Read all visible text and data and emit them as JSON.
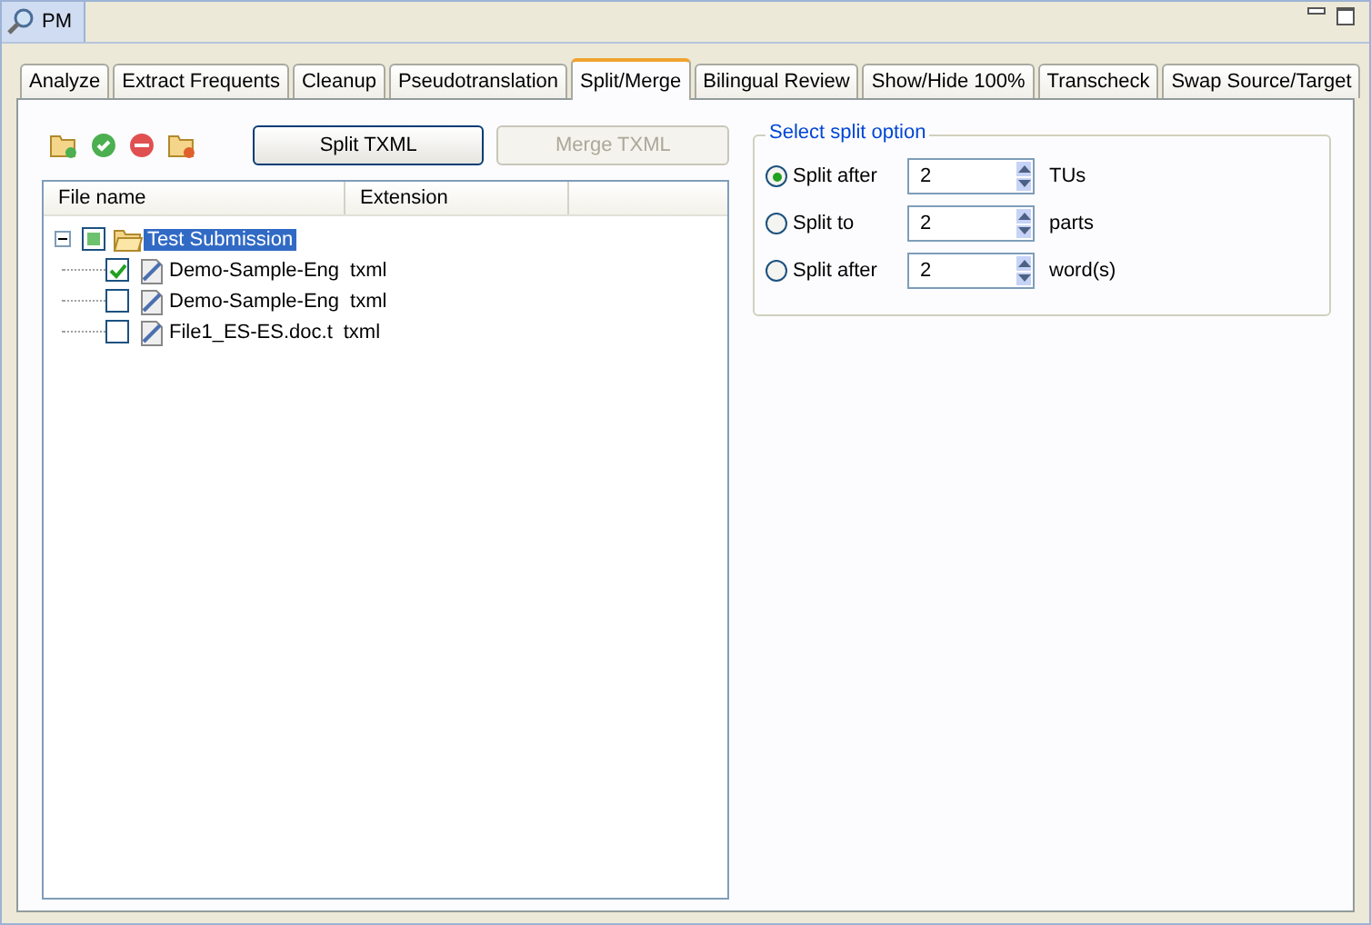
{
  "view_tab": {
    "title": "PM"
  },
  "tabs": [
    {
      "label": "Analyze",
      "selected": false
    },
    {
      "label": "Extract Frequents",
      "selected": false
    },
    {
      "label": "Cleanup",
      "selected": false
    },
    {
      "label": "Pseudotranslation",
      "selected": false
    },
    {
      "label": "Split/Merge",
      "selected": true
    },
    {
      "label": "Bilingual Review",
      "selected": false
    },
    {
      "label": "Show/Hide 100%",
      "selected": false
    },
    {
      "label": "Transcheck",
      "selected": false
    },
    {
      "label": "Swap Source/Target",
      "selected": false
    }
  ],
  "toolbar": {
    "buttons": [
      {
        "label": "Split TXML",
        "disabled": false
      },
      {
        "label": "Merge TXML",
        "disabled": true
      }
    ]
  },
  "tree": {
    "columns": [
      "File name",
      "Extension"
    ],
    "items": [
      {
        "name": "Test Submission",
        "kind": "folder",
        "checked": false,
        "partial": true,
        "expanded": true,
        "selected": true,
        "children": [
          {
            "name": "Demo-Sample-Eng",
            "extension": "txml",
            "kind": "file",
            "checked": true,
            "selected": false
          },
          {
            "name": "Demo-Sample-Eng",
            "extension": "txml",
            "kind": "file",
            "checked": false,
            "selected": false
          },
          {
            "name": "File1_ES-ES.doc.t",
            "extension": "txml",
            "kind": "file",
            "checked": false,
            "selected": false
          }
        ]
      }
    ]
  },
  "split_options": {
    "title": "Select split option",
    "options": [
      {
        "label": "Split after",
        "value": "2",
        "unit": "TUs",
        "selected": true
      },
      {
        "label": "Split to",
        "value": "2",
        "unit": "parts",
        "selected": false
      },
      {
        "label": "Split after",
        "value": "2",
        "unit": "word(s)",
        "selected": false
      }
    ]
  }
}
